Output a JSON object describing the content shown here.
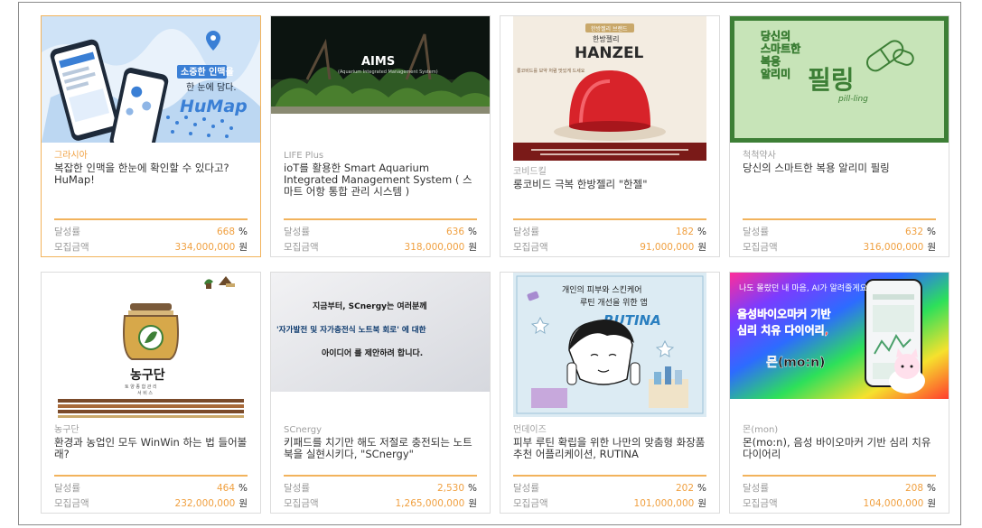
{
  "labels": {
    "rate": "달성률",
    "amount": "모집금액",
    "rate_unit": "%",
    "amount_unit": "원"
  },
  "cards": [
    {
      "maker": "그라시아",
      "title": "복잡한 인맥을 한눈에 확인할 수 있다고? HuMap!",
      "rate": "668",
      "amount": "334,000,000",
      "thumb": {
        "line1": "소중한 인맥을",
        "line2": "한 눈에 담다.",
        "brand": "HuMap"
      }
    },
    {
      "maker": "LIFE Plus",
      "title": "ioT를 활용한 Smart Aquarium Integrated Management System ( 스마트 어항 통합 관리 시스템 )",
      "rate": "636",
      "amount": "318,000,000",
      "thumb": {
        "brand": "AIMS",
        "sub": "(Aquarium Integrated Management System)"
      }
    },
    {
      "maker": "코비드킬",
      "title": "롱코비드 극복 한방젤리 \"한젤\"",
      "rate": "182",
      "amount": "91,000,000",
      "thumb": {
        "tag": "한방젤리 브랜드",
        "line1": "한방젤리",
        "brand": "HANZEL",
        "side": "롱코비드를 보약 처럼 맛있게 드세요"
      }
    },
    {
      "maker": "척척약사",
      "title": "당신의 스마트한 복용 알리미 필링",
      "rate": "632",
      "amount": "316,000,000",
      "thumb": {
        "line1": "당신의",
        "line2": "스마트한",
        "line3": "복용",
        "line4": "알리미",
        "brand": "필링",
        "sub": "pill-ling"
      }
    },
    {
      "maker": "농구단",
      "title": "환경과 농업인 모두 WinWin 하는 법 들어볼래?",
      "rate": "464",
      "amount": "232,000,000",
      "thumb": {
        "brand": "농구단",
        "sub1": "토 양 종 합 관 리",
        "sub2": "서 비 스"
      }
    },
    {
      "maker": "SCnergy",
      "title": "키패드를 치기만 해도 저절로 충전되는 노트북을 실현시키다, \"SCnergy\"",
      "rate": "2,530",
      "amount": "1,265,000,000",
      "thumb": {
        "line1": "지금부터, SCnergy는 여러분께",
        "line2": "'자가발전 및 자가충전식 노트북 회로' 에 대한",
        "line3": "아이디어 를 제안하려 합니다."
      }
    },
    {
      "maker": "먼데이즈",
      "title": "피부 루틴 확립을 위한 나만의 맞춤형 화장품 추천 어플리케이션, RUTINA",
      "rate": "202",
      "amount": "101,000,000",
      "thumb": {
        "line1": "개인의 피부와 스킨케어",
        "line2": "루틴 개선을 위한 앱",
        "brand": "RUTINA"
      }
    },
    {
      "maker": "몬(mon)",
      "title": "몬(mo:n), 음성 바이오마커 기반 심리 치유 다이어리",
      "rate": "208",
      "amount": "104,000,000",
      "thumb": {
        "line1": "나도 몰랐던 내 마음, AI가 알려줄게요",
        "line2": "음성바이오마커 기반",
        "line3": "심리 치유 다이어리,",
        "brand": "몬(mo:n)"
      }
    }
  ],
  "colors": {
    "accent": "#f0a040",
    "bar": "#f2b35c",
    "humap": "#3a7fd5",
    "pilling": "#3d7f36",
    "jelly": "#d8232a"
  }
}
